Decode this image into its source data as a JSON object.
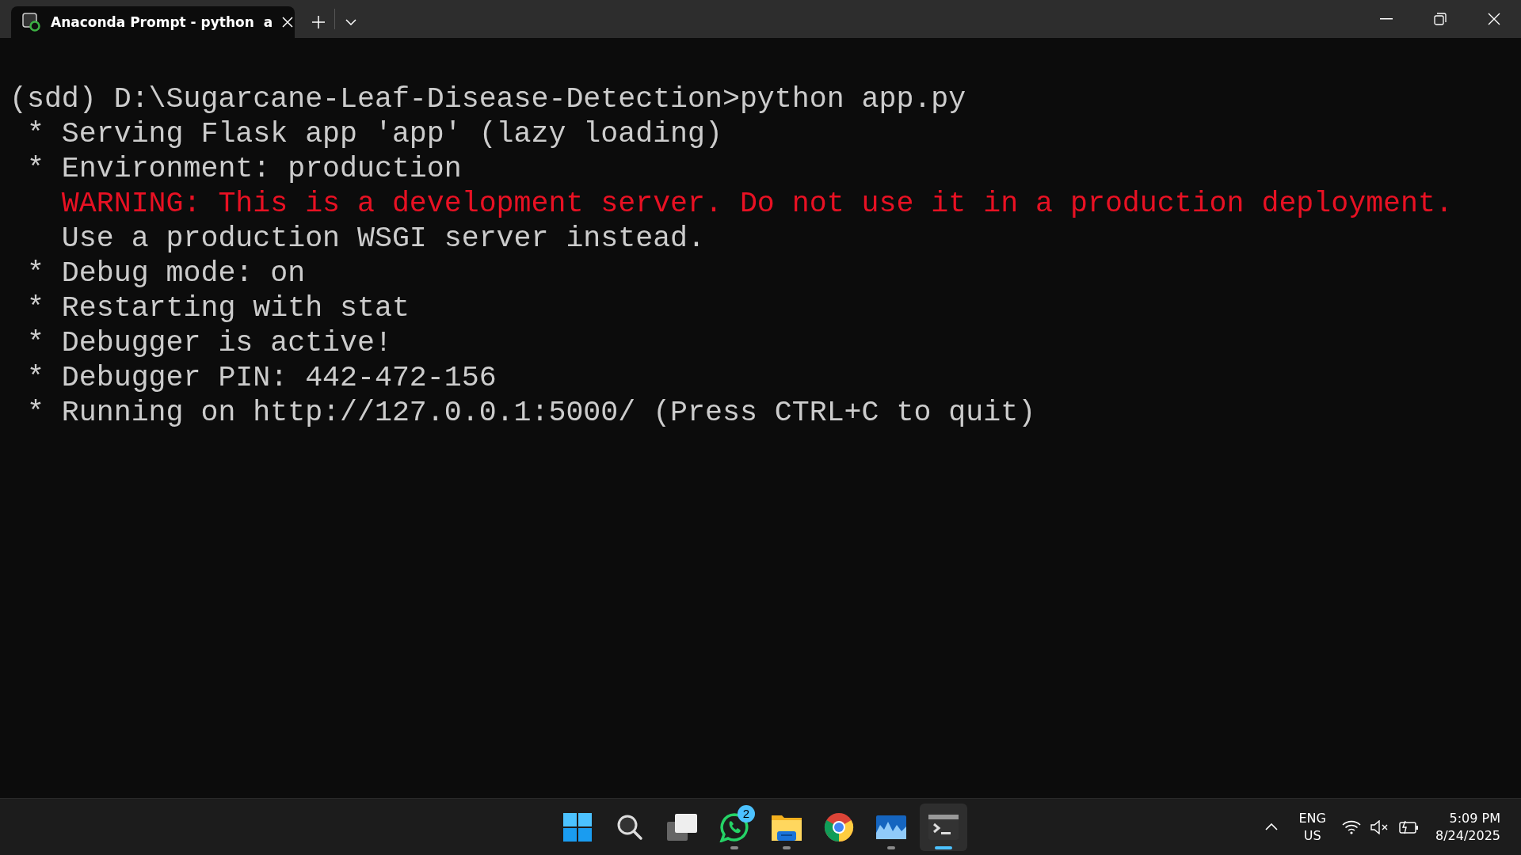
{
  "tab": {
    "title": "Anaconda Prompt - python  a",
    "selected": true
  },
  "terminal": {
    "lines": [
      {
        "kind": "normal",
        "text": "(sdd) D:\\Sugarcane-Leaf-Disease-Detection>python app.py"
      },
      {
        "kind": "normal",
        "text": " * Serving Flask app 'app' (lazy loading)"
      },
      {
        "kind": "normal",
        "text": " * Environment: production"
      },
      {
        "kind": "warning",
        "text": "   WARNING: This is a development server. Do not use it in a production deployment."
      },
      {
        "kind": "normal",
        "text": "   Use a production WSGI server instead."
      },
      {
        "kind": "normal",
        "text": " * Debug mode: on"
      },
      {
        "kind": "normal",
        "text": " * Restarting with stat"
      },
      {
        "kind": "normal",
        "text": " * Debugger is active!"
      },
      {
        "kind": "normal",
        "text": " * Debugger PIN: 442-472-156"
      },
      {
        "kind": "normal",
        "text": " * Running on http://127.0.0.1:5000/ (Press CTRL+C to quit)"
      }
    ]
  },
  "taskbar": {
    "apps": [
      {
        "kind": "start",
        "running": false,
        "selected": false
      },
      {
        "kind": "search",
        "running": false,
        "selected": false
      },
      {
        "kind": "taskview",
        "running": false,
        "selected": false
      },
      {
        "kind": "chat",
        "running": true,
        "selected": false,
        "badge": "2"
      },
      {
        "kind": "folder",
        "running": true,
        "selected": false
      },
      {
        "kind": "browser",
        "running": false,
        "selected": false
      },
      {
        "kind": "monitor",
        "running": true,
        "selected": false
      },
      {
        "kind": "terminal",
        "running": true,
        "selected": true
      }
    ],
    "language": {
      "line1": "ENG",
      "line2": "US"
    },
    "time": "5:09 PM",
    "date": "8/24/2025"
  }
}
